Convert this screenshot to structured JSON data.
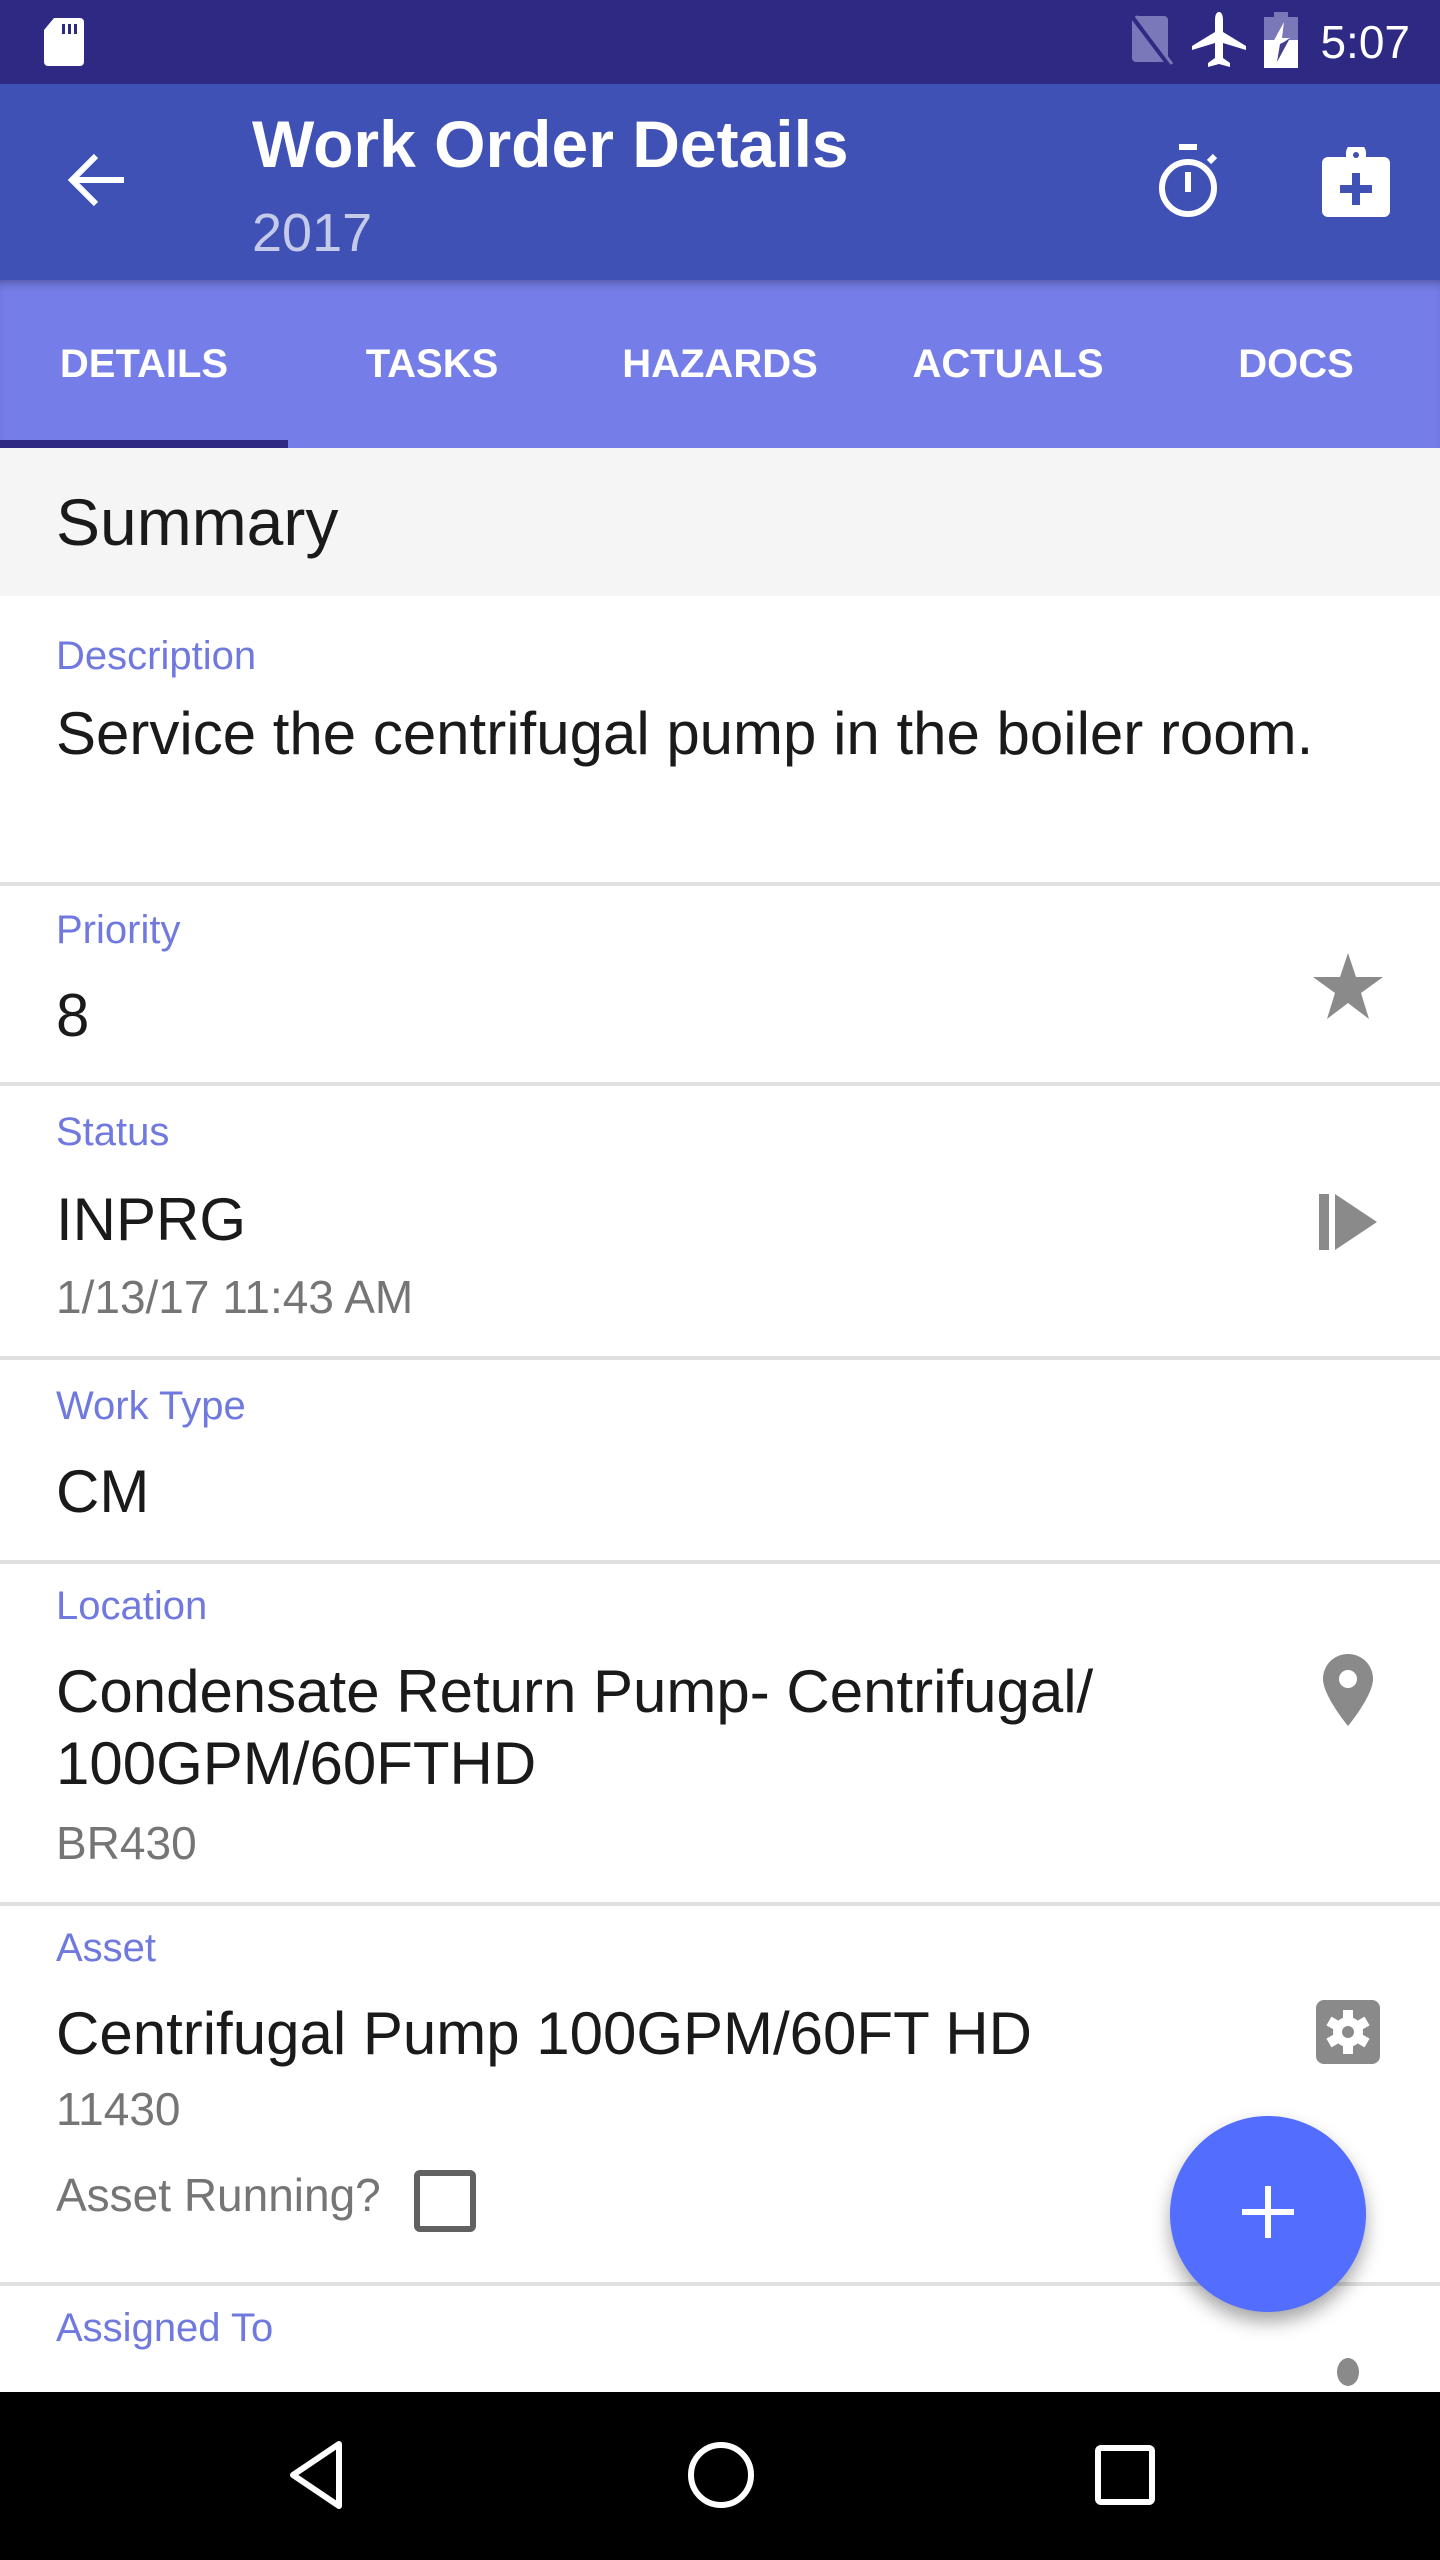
{
  "status_bar": {
    "time": "5:07",
    "icons": [
      "sd-card-icon",
      "no-sim-icon",
      "airplane-mode-icon",
      "battery-charging-icon"
    ]
  },
  "app_bar": {
    "title": "Work Order Details",
    "subtitle": "2017",
    "actions": [
      "back-arrow-icon",
      "stopwatch-icon",
      "clipboard-plus-icon"
    ]
  },
  "tabs": [
    {
      "label": "DETAILS",
      "active": true
    },
    {
      "label": "TASKS",
      "active": false
    },
    {
      "label": "HAZARDS",
      "active": false
    },
    {
      "label": "ACTUALS",
      "active": false
    },
    {
      "label": "DOCS",
      "active": false
    }
  ],
  "summary": {
    "title": "Summary",
    "fields": {
      "description": {
        "label": "Description",
        "value": "Service the centrifugal pump in the boiler room."
      },
      "priority": {
        "label": "Priority",
        "value": "8",
        "icon": "star-icon"
      },
      "status": {
        "label": "Status",
        "value": "INPRG",
        "sub": "1/13/17 11:43 AM",
        "icon": "change-status-icon"
      },
      "work_type": {
        "label": "Work Type",
        "value": "CM"
      },
      "location": {
        "label": "Location",
        "value": "Condensate Return Pump- Centrifugal/ 100GPM/60FTHD",
        "sub": "BR430",
        "icon": "map-pin-icon"
      },
      "asset": {
        "label": "Asset",
        "value": "Centrifugal Pump 100GPM/60FT HD",
        "sub": "11430",
        "icon": "asset-settings-icon",
        "running_label": "Asset Running?",
        "running_checked": false
      },
      "assigned_to": {
        "label": "Assigned To"
      }
    }
  },
  "fab": {
    "icon": "plus-icon"
  },
  "nav_bar": {
    "buttons": [
      "back-triangle-icon",
      "home-circle-icon",
      "recents-square-icon"
    ]
  },
  "colors": {
    "status_bar": "#2e2a84",
    "app_bar": "#3f51b5",
    "tabs": "#757de8",
    "tab_indicator": "#2e2a84",
    "label": "#7079de",
    "fab": "#536dfe",
    "icon_gray": "#8a8a8a"
  }
}
